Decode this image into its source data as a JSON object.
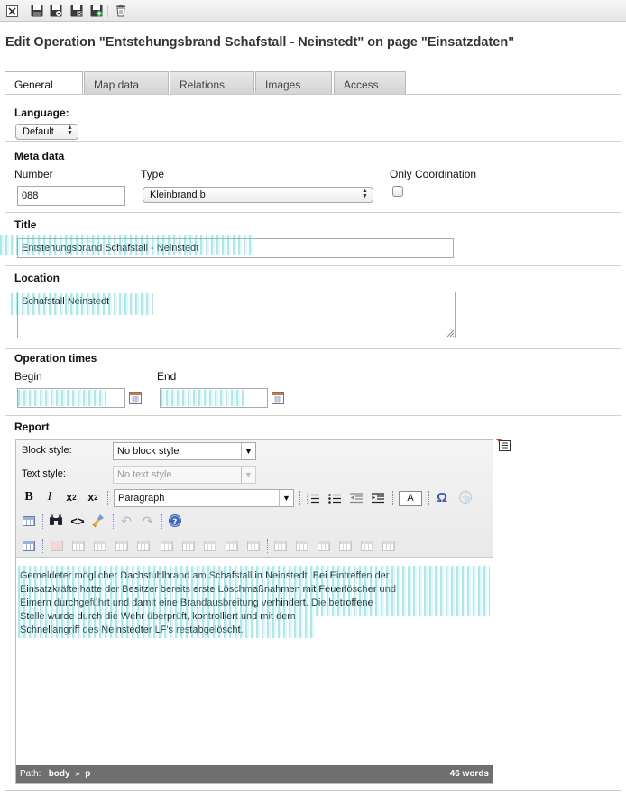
{
  "toolbar": {
    "buttons": [
      "close-icon",
      "save-icon",
      "save-and-view-icon",
      "save-and-close-icon",
      "save-and-new-icon",
      "delete-icon"
    ]
  },
  "page_title": "Edit Operation \"Entstehungsbrand Schafstall - Neinstedt\" on page \"Einsatzdaten\"",
  "tabs": [
    {
      "label": "General",
      "active": true
    },
    {
      "label": "Map data",
      "active": false
    },
    {
      "label": "Relations",
      "active": false
    },
    {
      "label": "Images",
      "active": false
    },
    {
      "label": "Access",
      "active": false
    }
  ],
  "general": {
    "language_label": "Language:",
    "language_value": "Default"
  },
  "meta": {
    "title": "Meta data",
    "number_label": "Number",
    "number_value": "088",
    "type_label": "Type",
    "type_value": "Kleinbrand b",
    "coordination_label": "Only Coordination",
    "coordination_checked": false
  },
  "title_section": {
    "title": "Title",
    "value": "Entstehungsbrand Schafstall - Neinstedt"
  },
  "location_section": {
    "title": "Location",
    "value": "Schafstall Neinstedt"
  },
  "times": {
    "title": "Operation times",
    "begin_label": "Begin",
    "begin_value": "",
    "end_label": "End",
    "end_value": ""
  },
  "report": {
    "title": "Report",
    "block_style_label": "Block style:",
    "block_style_value": "No block style",
    "text_style_label": "Text style:",
    "text_style_value": "No text style",
    "format_value": "Paragraph",
    "text_color_button": "A",
    "content_lines": [
      "Gemeldeter möglicher Dachstuhlbrand am Schafstall in Neinstedt. Bei Eintreffen der",
      "Einsatzkräfte hatte der Besitzer bereits erste Löschmaßnahmen mit Feuerlöscher und",
      "Eimern durchgeführt und damit eine Brandausbreitung verhindert. Die betroffene",
      "Stelle wurde durch die Wehr überprüft, kontrolliert und mit dem",
      "Schnellangriff des Neinstedter LF's restabgelöscht."
    ],
    "path_label": "Path:",
    "path_body": "body",
    "path_sep": "»",
    "path_p": "p",
    "word_count": "46 words"
  },
  "colors": {
    "accent": "#4a6fb5",
    "status_bar": "#6f6f6f",
    "redaction": "#46cdd7"
  }
}
